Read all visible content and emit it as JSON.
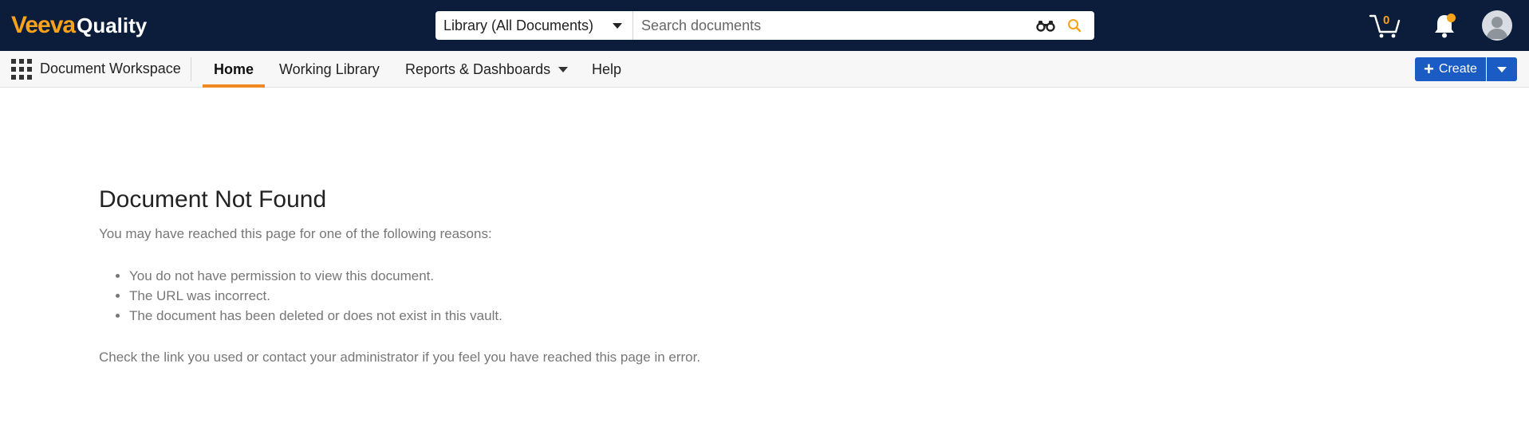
{
  "header": {
    "brand": "Veeva",
    "product": "Quality",
    "search": {
      "scope": "Library (All Documents)",
      "placeholder": "Search documents"
    },
    "cart_count": "0"
  },
  "nav": {
    "workspace": "Document Workspace",
    "tabs": [
      {
        "label": "Home",
        "active": true
      },
      {
        "label": "Working Library"
      },
      {
        "label": "Reports & Dashboards"
      },
      {
        "label": "Help"
      }
    ],
    "create_label": "Create"
  },
  "content": {
    "title": "Document Not Found",
    "intro": "You may have reached this page for one of the following reasons:",
    "reasons": [
      "You do not have permission to view this document.",
      "The URL was incorrect.",
      "The document has been deleted or does not exist in this vault."
    ],
    "closing": "Check the link you used or contact your administrator if you feel you have reached this page in error."
  },
  "colors": {
    "topbar": "#0b1d3a",
    "brand_accent": "#f7a21b",
    "active_tab_underline": "#f08a24",
    "primary_button": "#1a5bc4"
  },
  "icons": [
    "apps-grid-icon",
    "binoculars-icon",
    "search-icon",
    "cart-icon",
    "bell-icon",
    "user-avatar-icon",
    "plus-icon",
    "caret-down-icon"
  ]
}
